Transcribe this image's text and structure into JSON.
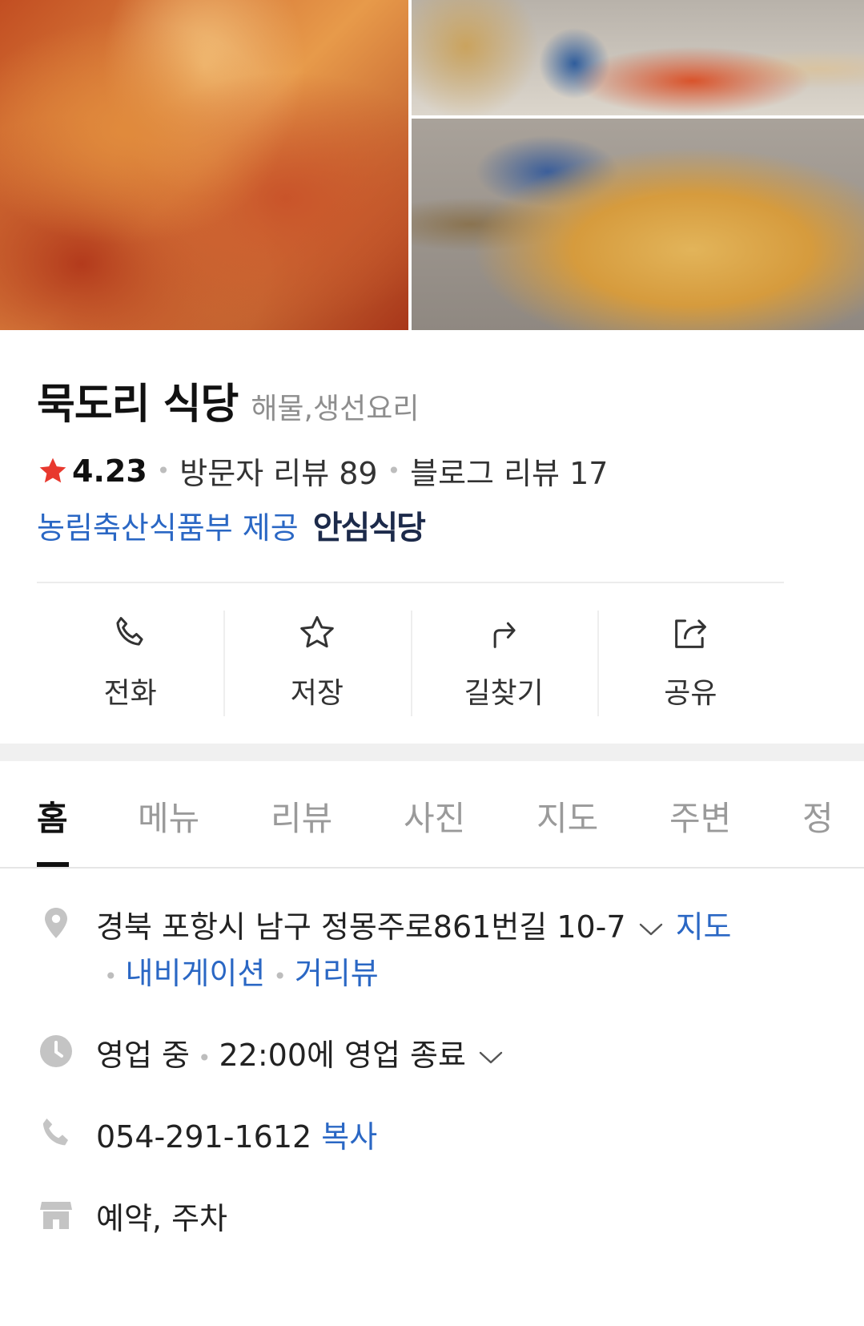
{
  "photos": [
    {
      "label": "spicy-seafood-stir-fry"
    },
    {
      "label": "side-dishes-table"
    },
    {
      "label": "fish-stew-pot"
    }
  ],
  "place": {
    "name": "묵도리 식당",
    "category": "해물,생선요리",
    "rating": "4.23",
    "visitor_reviews": "방문자 리뷰 89",
    "blog_reviews": "블로그 리뷰 17",
    "certification_provider": "농림축산식품부 제공",
    "certification_badge": "안심식당"
  },
  "actions": [
    {
      "label": "전화",
      "icon": "phone-icon"
    },
    {
      "label": "저장",
      "icon": "star-outline-icon"
    },
    {
      "label": "길찾기",
      "icon": "directions-icon"
    },
    {
      "label": "공유",
      "icon": "share-icon"
    }
  ],
  "tabs": [
    {
      "label": "홈",
      "active": true
    },
    {
      "label": "메뉴"
    },
    {
      "label": "리뷰"
    },
    {
      "label": "사진"
    },
    {
      "label": "지도"
    },
    {
      "label": "주변"
    },
    {
      "label": "정"
    }
  ],
  "info": {
    "address": "경북 포항시 남구 정몽주로861번길 10-7",
    "address_map_link": "지도",
    "navigation_link": "내비게이션",
    "street_view_link": "거리뷰",
    "status": "영업 중",
    "hours": "22:00에 영업 종료",
    "phone": "054-291-1612",
    "copy_link": "복사",
    "amenities": "예약, 주차"
  },
  "colors": {
    "accent_blue": "#2a67c4",
    "star_red": "#e8382e",
    "icon_gray": "#bdbdbd"
  }
}
